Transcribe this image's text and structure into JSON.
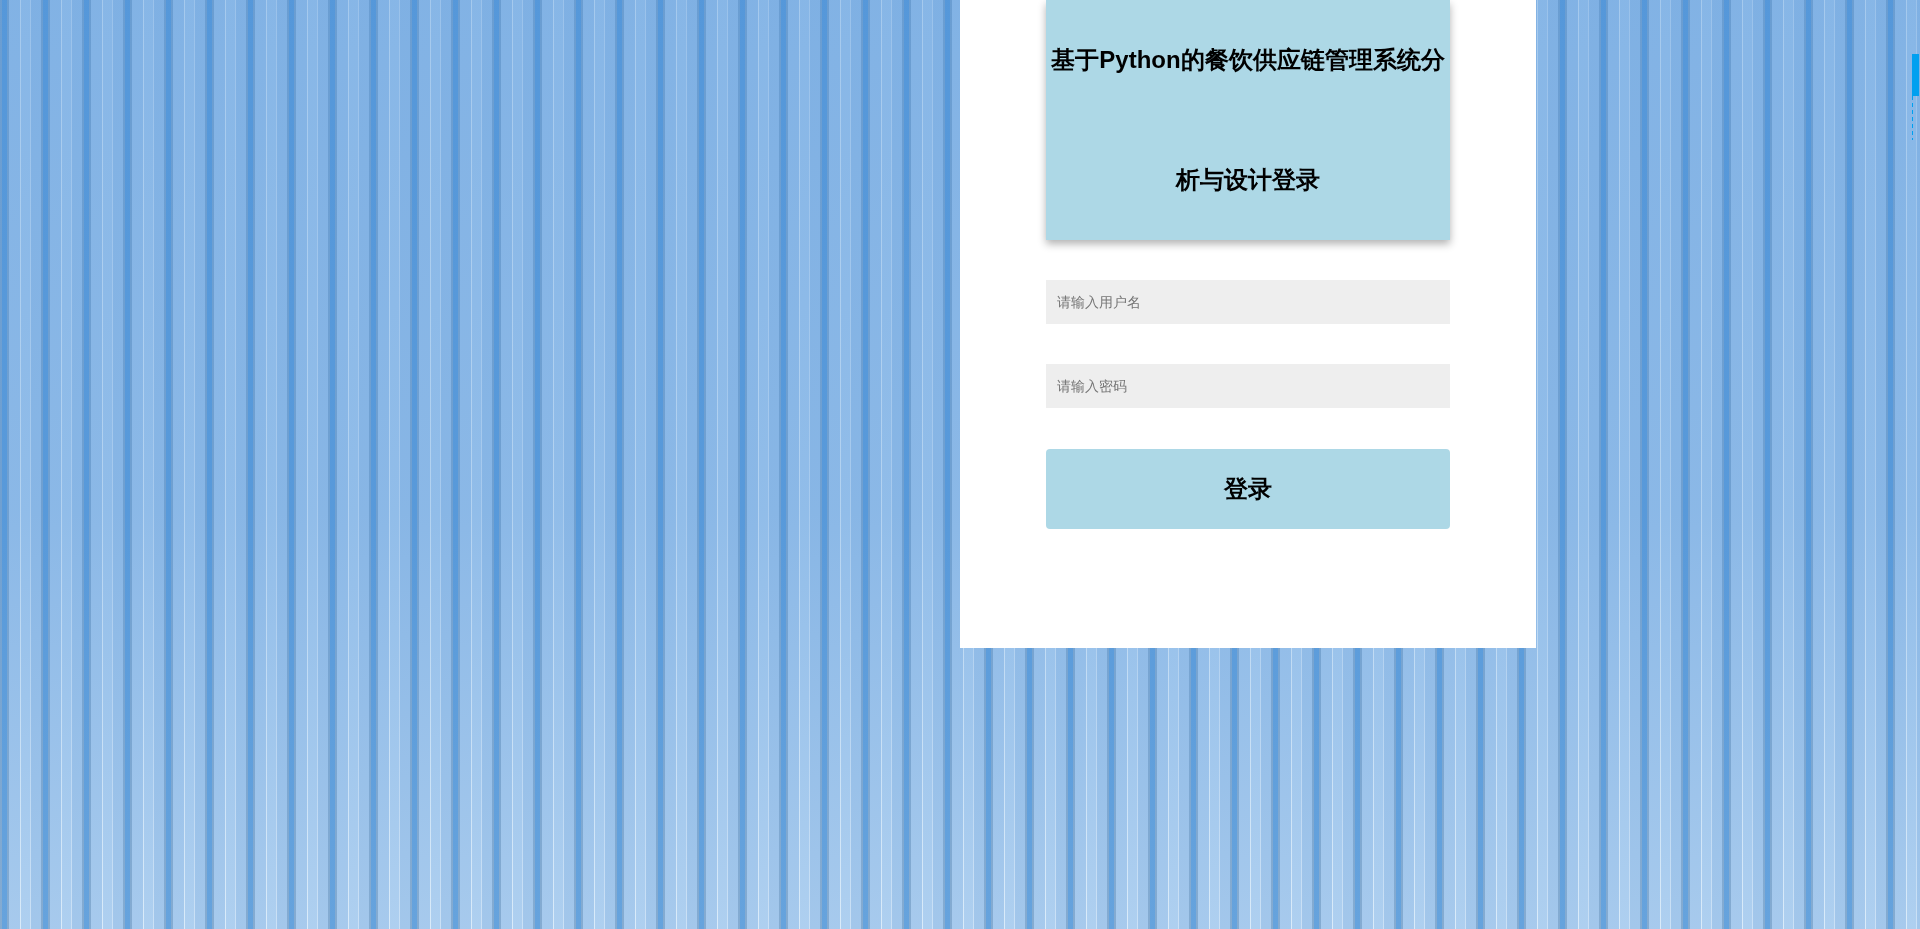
{
  "title": "基于Python的餐饮供应链管理系统分析与设计登录",
  "username_field": {
    "placeholder": "请输入用户名"
  },
  "password_field": {
    "placeholder": "请输入密码"
  },
  "login_button": {
    "label": "登录"
  }
}
